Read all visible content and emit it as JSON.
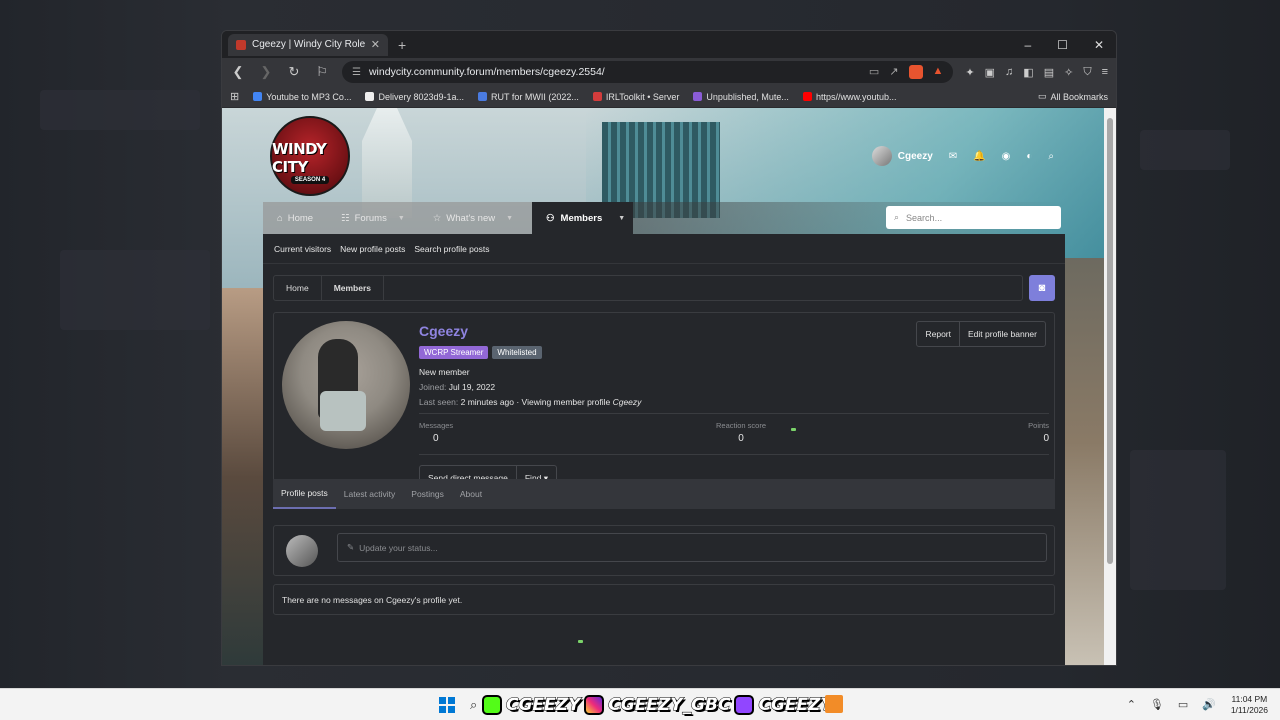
{
  "browser": {
    "tab_title": "Cgeezy | Windy City Roleplay",
    "url": "windycity.community.forum/members/cgeezy.2554/",
    "bookmarks": [
      {
        "label": "Youtube to MP3 Co...",
        "color": "#4285f4"
      },
      {
        "label": "Delivery 8023d9-1a...",
        "color": "#222222"
      },
      {
        "label": "RUT for MWII (2022...",
        "color": "#4a7be0"
      },
      {
        "label": "IRLToolkit • Server",
        "color": "#d33c3c"
      },
      {
        "label": "Unpublished, Mute...",
        "color": "#8a5cd6"
      },
      {
        "label": "https//www.youtub...",
        "color": "#ff0000"
      }
    ],
    "all_bookmarks": "All Bookmarks"
  },
  "site": {
    "logo_line1": "WINDY CITY",
    "logo_line2": "SEASON 4",
    "username": "Cgeezy",
    "nav": {
      "home": "Home",
      "forums": "Forums",
      "whats_new": "What's new",
      "members": "Members"
    },
    "search_placeholder": "Search...",
    "subnav": [
      "Current visitors",
      "New profile posts",
      "Search profile posts"
    ],
    "breadcrumb": [
      "Home",
      "Members"
    ]
  },
  "profile": {
    "name": "Cgeezy",
    "badges": [
      "WCRP Streamer",
      "Whitelisted"
    ],
    "title": "New member",
    "joined_label": "Joined:",
    "joined_value": "Jul 19, 2022",
    "last_seen_label": "Last seen:",
    "last_seen_value": "2 minutes ago · Viewing member profile",
    "last_seen_name": "Cgeezy",
    "report": "Report",
    "edit_banner": "Edit profile banner",
    "stats": [
      {
        "label": "Messages",
        "value": "0"
      },
      {
        "label": "Reaction score",
        "value": "0"
      },
      {
        "label": "Points",
        "value": "0"
      }
    ],
    "send_dm": "Send direct message",
    "find": "Find",
    "tabs": [
      "Profile posts",
      "Latest activity",
      "Postings",
      "About"
    ],
    "status_placeholder": "Update your status...",
    "empty_message": "There are no messages on Cgeezy's profile yet."
  },
  "taskbar": {
    "social_handles": [
      "CGEEZY",
      "CGEEZY_GBC",
      "CGEEZY"
    ],
    "time": "11:04 PM",
    "date": "1/11/2026"
  },
  "colors": {
    "accent_purple": "#8f84e0",
    "badge_streamer": "#9268d6",
    "discord": "#7e7fdb"
  }
}
